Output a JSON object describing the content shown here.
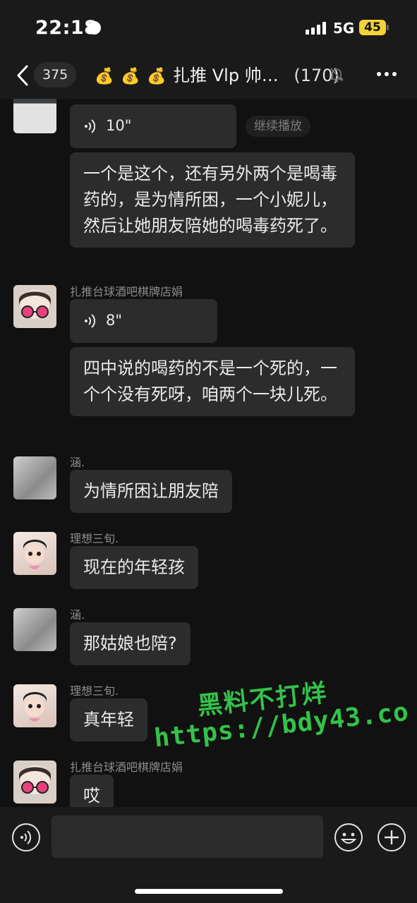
{
  "status_bar": {
    "time": "22:18",
    "network": "5G",
    "battery": "45"
  },
  "header": {
    "back_icon": "chevron-left-icon",
    "unread_count": "375",
    "title_emoji": "💰",
    "title": "扎推 Vlp 帅…",
    "member_count": "(170)",
    "mute_icon": "bell-slash-icon",
    "more_icon": "ellipsis-icon"
  },
  "messages": [
    {
      "sender": "",
      "voice_length": "10\"",
      "continue_label": "继续播放",
      "text": "一个是这个，还有另外两个是喝毒药的，是为情所困，一个小妮儿，然后让她朋友陪她的喝毒药死了。"
    },
    {
      "sender": "扎推台球酒吧棋牌店娟",
      "voice_length": "8\"",
      "text": "四中说的喝药的不是一个死的，一个个没有死呀，咱两个一块儿死。"
    },
    {
      "sender": "涵.",
      "text": "为情所困让朋友陪"
    },
    {
      "sender": "理想三旬.",
      "text": "现在的年轻孩"
    },
    {
      "sender": "涵.",
      "text": "那姑娘也陪?"
    },
    {
      "sender": "理想三旬.",
      "text": "真年轻"
    },
    {
      "sender": "扎推台球酒吧棋牌店娟",
      "text": "哎"
    }
  ],
  "watermark": {
    "line1": "黑料不打烊",
    "line2": "https://bdy43.co"
  },
  "input_bar": {
    "voice_icon": "voice-wave-icon",
    "placeholder": "",
    "emoji_icon": "smiley-icon",
    "plus_icon": "plus-circle-icon"
  },
  "colors": {
    "background": "#111111",
    "bubble": "#2c2c2c",
    "watermark": "#33c24a",
    "battery": "#f2d23a"
  }
}
